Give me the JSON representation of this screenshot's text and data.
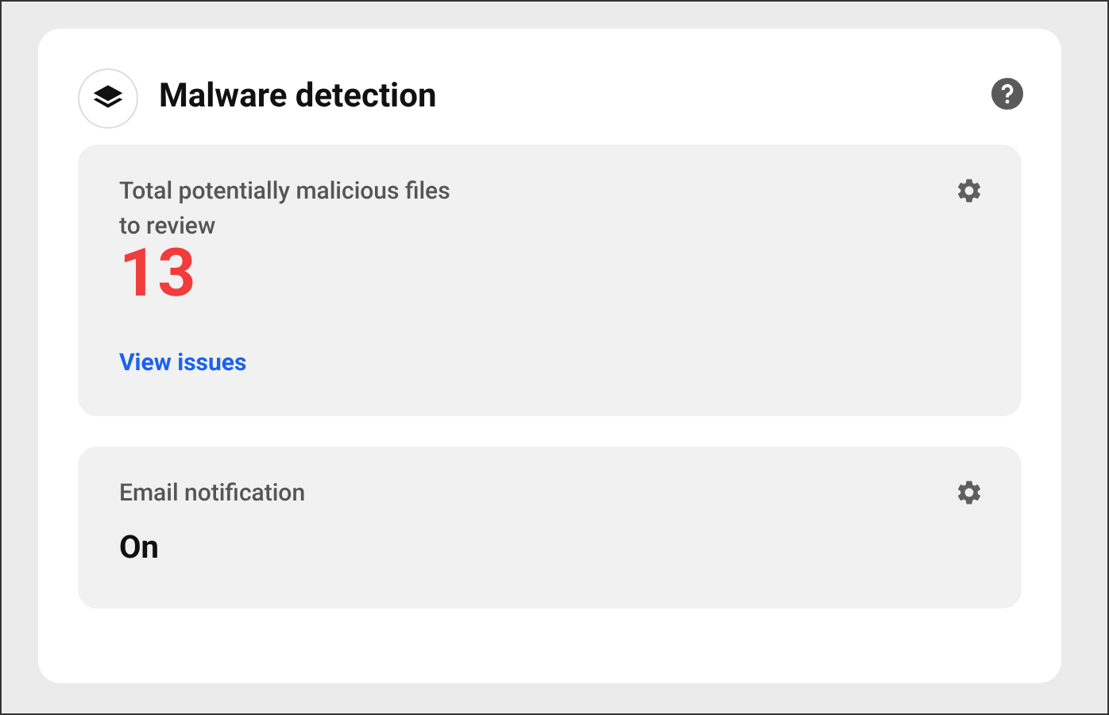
{
  "card": {
    "title": "Malware detection"
  },
  "panels": [
    {
      "kind": "count",
      "label": "Total potentially malicious files to review",
      "value": "13",
      "link": "View issues"
    },
    {
      "kind": "status",
      "label": "Email notification",
      "value": "On"
    }
  ]
}
